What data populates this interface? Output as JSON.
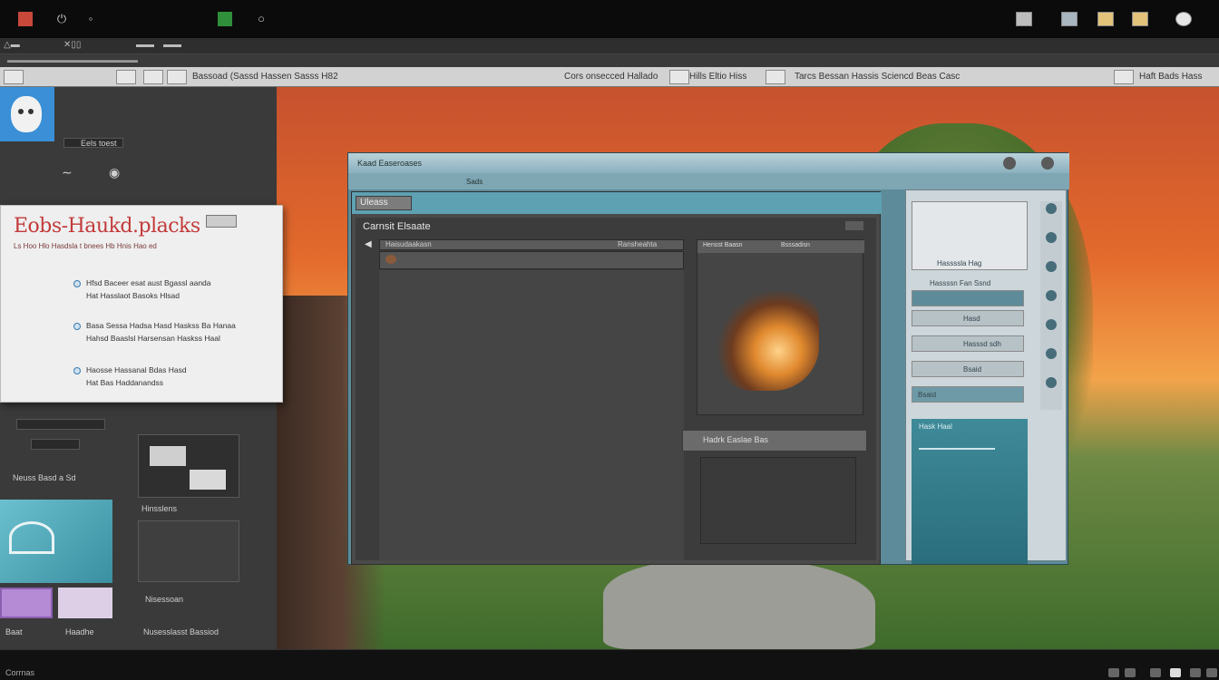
{
  "toolbar": {
    "left_text": "Bassoad (Sassd Hassen Sasss H82",
    "middle_text": "Cors onsecced Hallado",
    "menu_text": "Hills Eltio Hiss",
    "right_text": "Tarcs Bessan Hassis Sciencd Beas Casc",
    "end_text": "Haft Bads Hass"
  },
  "sidebar": {
    "tag_label": "Eels toest",
    "item1": "Neuss Basd a Sd",
    "thumb_caption": "Hinsslens",
    "item2": "Nisessoan",
    "foot_left": "Baat",
    "foot_mid": "Haadhe",
    "foot_right": "Nusesslasst Bassiod"
  },
  "dialog": {
    "title": "Eobs-Haukd.placks",
    "subtitle": "Ls Hoo Hlo Hasdsla t bnees Hb Hnis Hao ed",
    "lines": [
      "Hfsd Baceer esat aust Bgassl aanda",
      "Hat Hasslaot Basoks Hlsad",
      "Basa Sessa Hadsa Hasd Haskss Ba Hanaa",
      "Hahsd Baaslsl Harsensan Haskss Haal",
      "Haosse Hassanal Bdas Hasd",
      "Hat Bas Haddanandss"
    ]
  },
  "window": {
    "title": "Kaad Easeroases",
    "bar2": "Sads",
    "tab": "Uleass",
    "section": "Carnsit Elsaate",
    "row_label": "Haisudaakasn",
    "col_right": "Ransheahta",
    "preview_tab1": "Hensst Baasn",
    "preview_tab2": "Bsssadisn",
    "status": "Hadrk Easlae Bas"
  },
  "rpanel": {
    "row1": "Hassssla Hag",
    "row2": "Hassssn Fan Ssnd",
    "row3": "Hasd",
    "row4": "Hasssd sdh",
    "row5": "Bsaid",
    "row6": "Bsaid",
    "teal_label": "Hask Haal"
  },
  "taskbar": {
    "label": "Corrnas"
  }
}
